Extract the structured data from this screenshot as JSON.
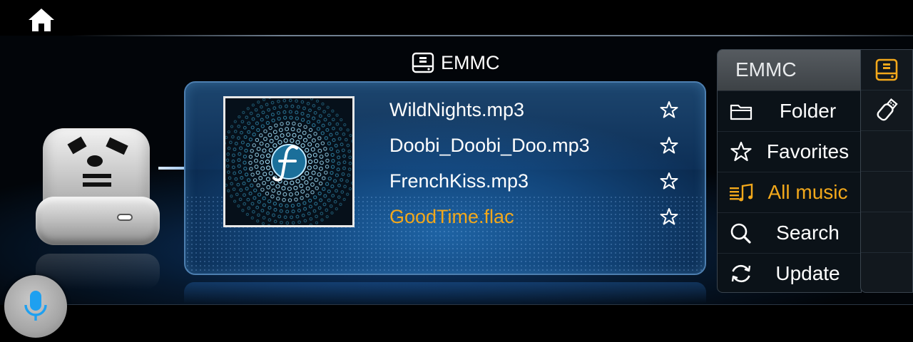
{
  "header": {
    "home_icon": "home-icon"
  },
  "source": {
    "title": "EMMC",
    "icon": "storage-icon"
  },
  "tracks": [
    {
      "name": "WildNights.mp3",
      "active": false
    },
    {
      "name": "Doobi_Doobi_Doo.mp3",
      "active": false
    },
    {
      "name": "FrenchKiss.mp3",
      "active": false
    },
    {
      "name": "GoodTime.flac",
      "active": true
    }
  ],
  "menu": {
    "header": "EMMC",
    "items": [
      {
        "label": "Folder",
        "icon": "folder-icon",
        "active": false
      },
      {
        "label": "Favorites",
        "icon": "star-icon",
        "active": false
      },
      {
        "label": "All music",
        "icon": "music-list-icon",
        "active": true
      },
      {
        "label": "Search",
        "icon": "search-icon",
        "active": false
      },
      {
        "label": "Update",
        "icon": "refresh-icon",
        "active": false
      }
    ]
  },
  "rail": [
    {
      "icon": "storage-icon",
      "selected": true
    },
    {
      "icon": "usb-icon",
      "selected": false
    }
  ],
  "voice": {
    "icon": "microphone-icon"
  },
  "colors": {
    "accent": "#f2a81b",
    "mic": "#1ea0f0",
    "panel_border": "#4d7fb0"
  }
}
